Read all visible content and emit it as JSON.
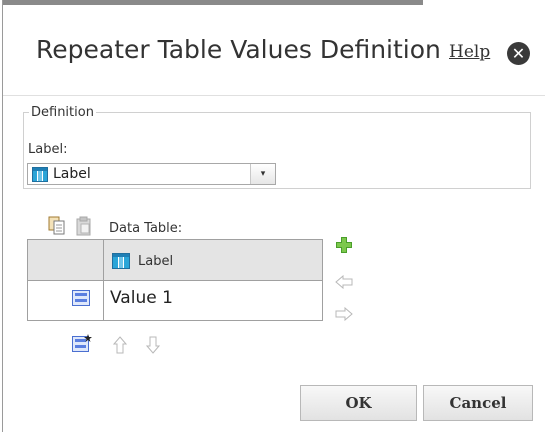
{
  "dialog": {
    "title": "Repeater Table Values Definition",
    "help_label": "Help",
    "close_glyph": "✕"
  },
  "definition": {
    "legend": "Definition",
    "label_caption": "Label:",
    "select_value": "Label",
    "select_arrow": "▾"
  },
  "data_table": {
    "caption": "Data Table:",
    "header_column": "Label",
    "rows": [
      {
        "value": "Value 1"
      }
    ]
  },
  "toolbar_icons": [
    "copy-icon",
    "paste-icon",
    "add-column-icon",
    "move-left-icon",
    "move-right-icon",
    "add-row-icon",
    "move-up-icon",
    "move-down-icon"
  ],
  "buttons": {
    "ok": "OK",
    "cancel": "Cancel"
  },
  "colors": {
    "accent_teal": "#1f7fb5",
    "add_green": "#4a9e2a"
  }
}
